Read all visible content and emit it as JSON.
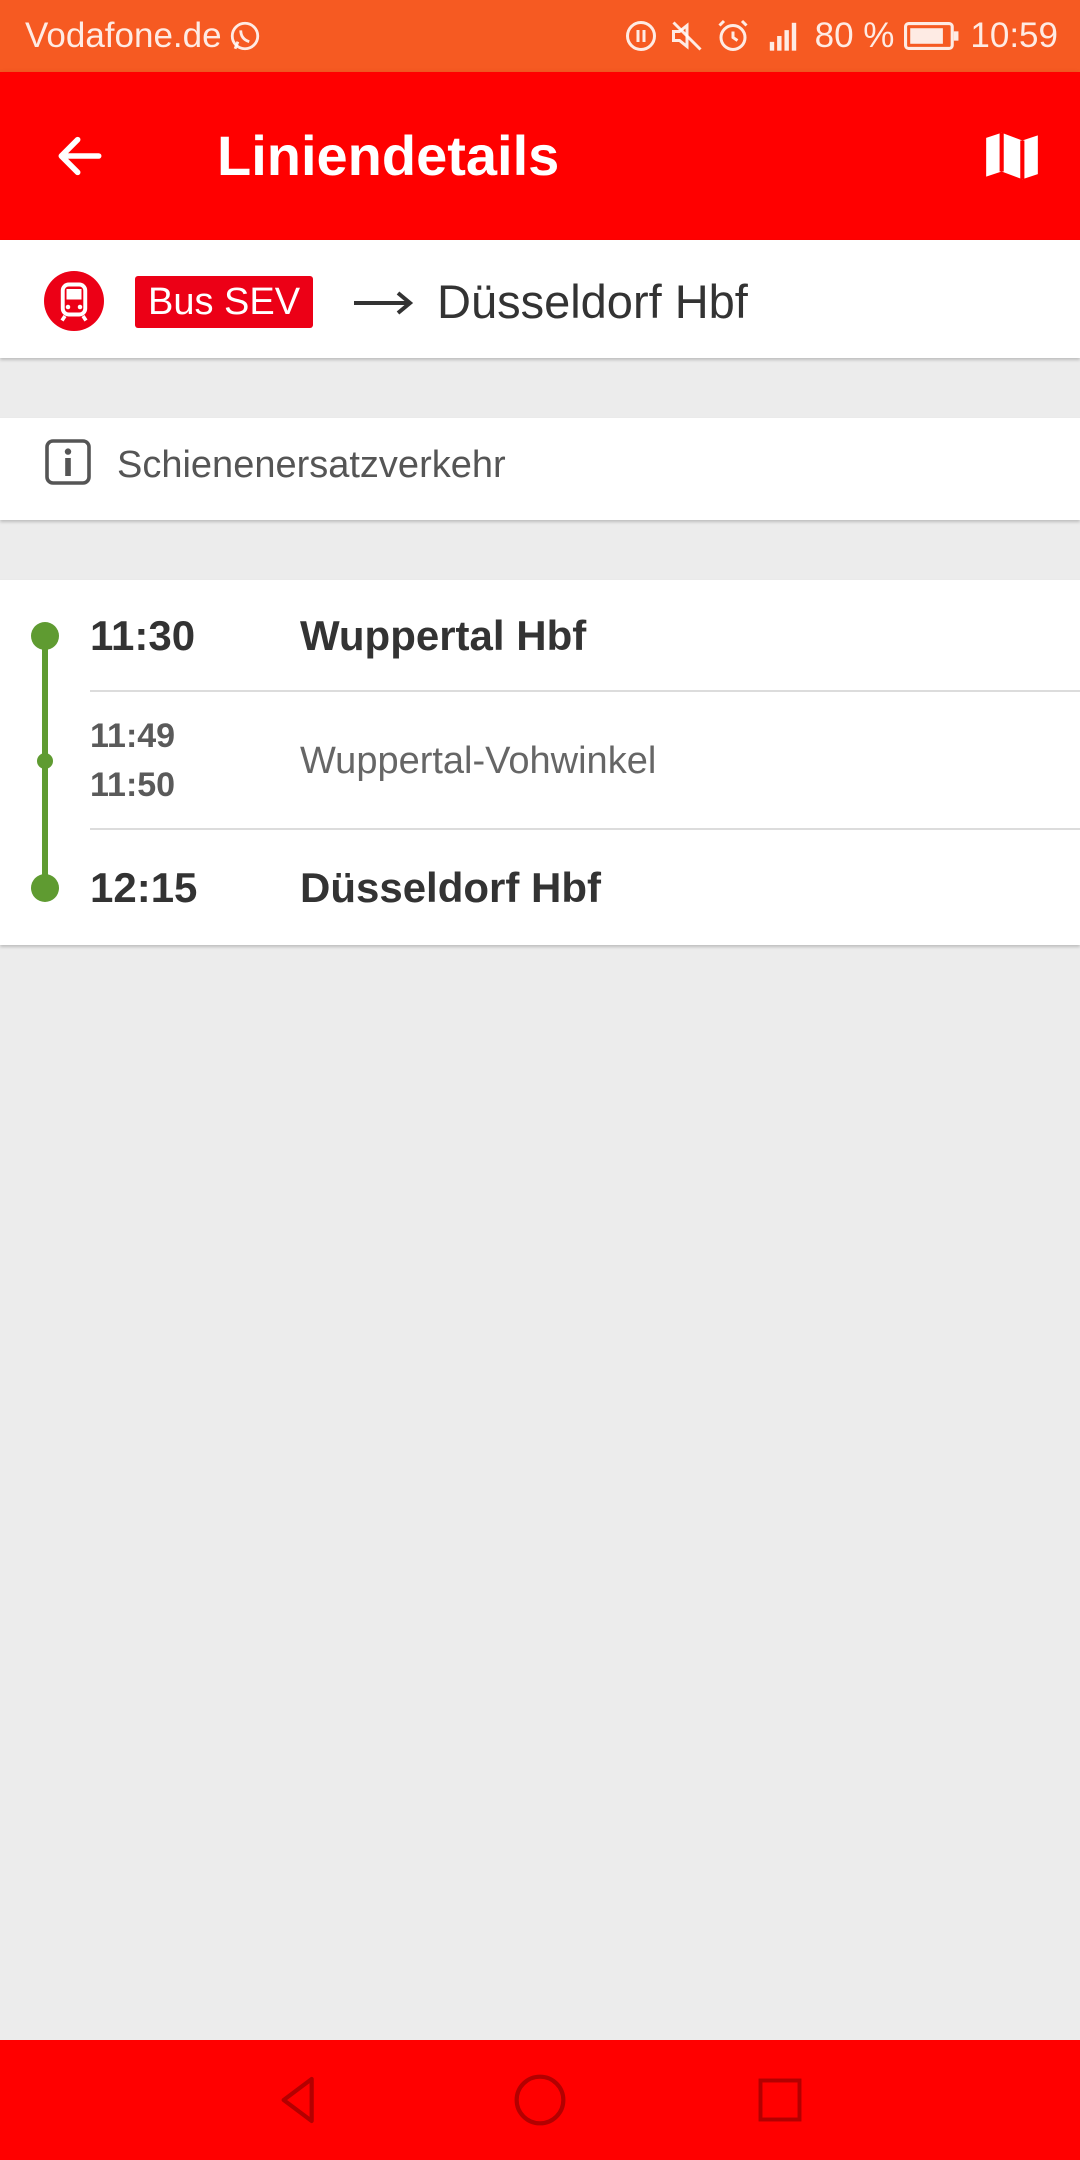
{
  "status_bar": {
    "carrier": "Vodafone.de",
    "battery": "80 %",
    "time": "10:59",
    "icons": [
      "whatsapp-icon",
      "data-saver-icon",
      "mute-icon",
      "alarm-icon",
      "signal-icon",
      "battery-icon"
    ]
  },
  "app_bar": {
    "title": "Liniendetails",
    "back_icon": "arrow-left-icon",
    "map_icon": "map-icon"
  },
  "line": {
    "badge": "Bus SEV",
    "destination": "Düsseldorf Hbf",
    "icon": "train-icon"
  },
  "info": {
    "text": "Schienenersatzverkehr",
    "icon": "info-icon"
  },
  "stops": [
    {
      "time": "11:30",
      "name": "Wuppertal Hbf"
    },
    {
      "arrival": "11:49",
      "departure": "11:50",
      "name": "Wuppertal-Vohwinkel"
    },
    {
      "time": "12:15",
      "name": "Düsseldorf Hbf"
    }
  ],
  "colors": {
    "status_bar": "#f65a22",
    "app_bar": "#ff0000",
    "badge": "#ec0016",
    "route": "#5f9b31",
    "background": "#ececec"
  },
  "nav": {
    "icons": [
      "back-triangle-icon",
      "home-circle-icon",
      "recents-square-icon"
    ]
  }
}
